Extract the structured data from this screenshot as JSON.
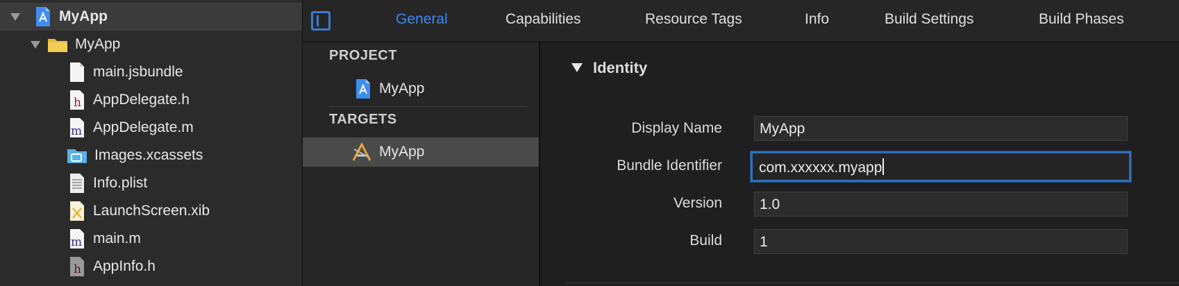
{
  "navigator": {
    "items": [
      {
        "label": "MyApp",
        "kind": "project",
        "expanded": true
      },
      {
        "label": "MyApp",
        "kind": "folder",
        "expanded": true
      },
      {
        "label": "main.jsbundle",
        "kind": "file"
      },
      {
        "label": "AppDelegate.h",
        "kind": "header"
      },
      {
        "label": "AppDelegate.m",
        "kind": "impl"
      },
      {
        "label": "Images.xcassets",
        "kind": "assets"
      },
      {
        "label": "Info.plist",
        "kind": "plist"
      },
      {
        "label": "LaunchScreen.xib",
        "kind": "xib"
      },
      {
        "label": "main.m",
        "kind": "impl"
      },
      {
        "label": "AppInfo.h",
        "kind": "header"
      }
    ]
  },
  "tabs": [
    "General",
    "Capabilities",
    "Resource Tags",
    "Info",
    "Build Settings",
    "Build Phases"
  ],
  "active_tab": "General",
  "targets_panel": {
    "project_header": "PROJECT",
    "project_item": "MyApp",
    "targets_header": "TARGETS",
    "target_item": "MyApp"
  },
  "identity": {
    "section_title": "Identity",
    "display_name_label": "Display Name",
    "display_name_value": "MyApp",
    "bundle_id_label": "Bundle Identifier",
    "bundle_id_value": "com.xxxxxx.myapp",
    "version_label": "Version",
    "version_value": "1.0",
    "build_label": "Build",
    "build_value": "1"
  },
  "colors": {
    "accent": "#3a86f5",
    "focus_ring": "#2f6fb5",
    "selection": "#4a4a4a"
  }
}
